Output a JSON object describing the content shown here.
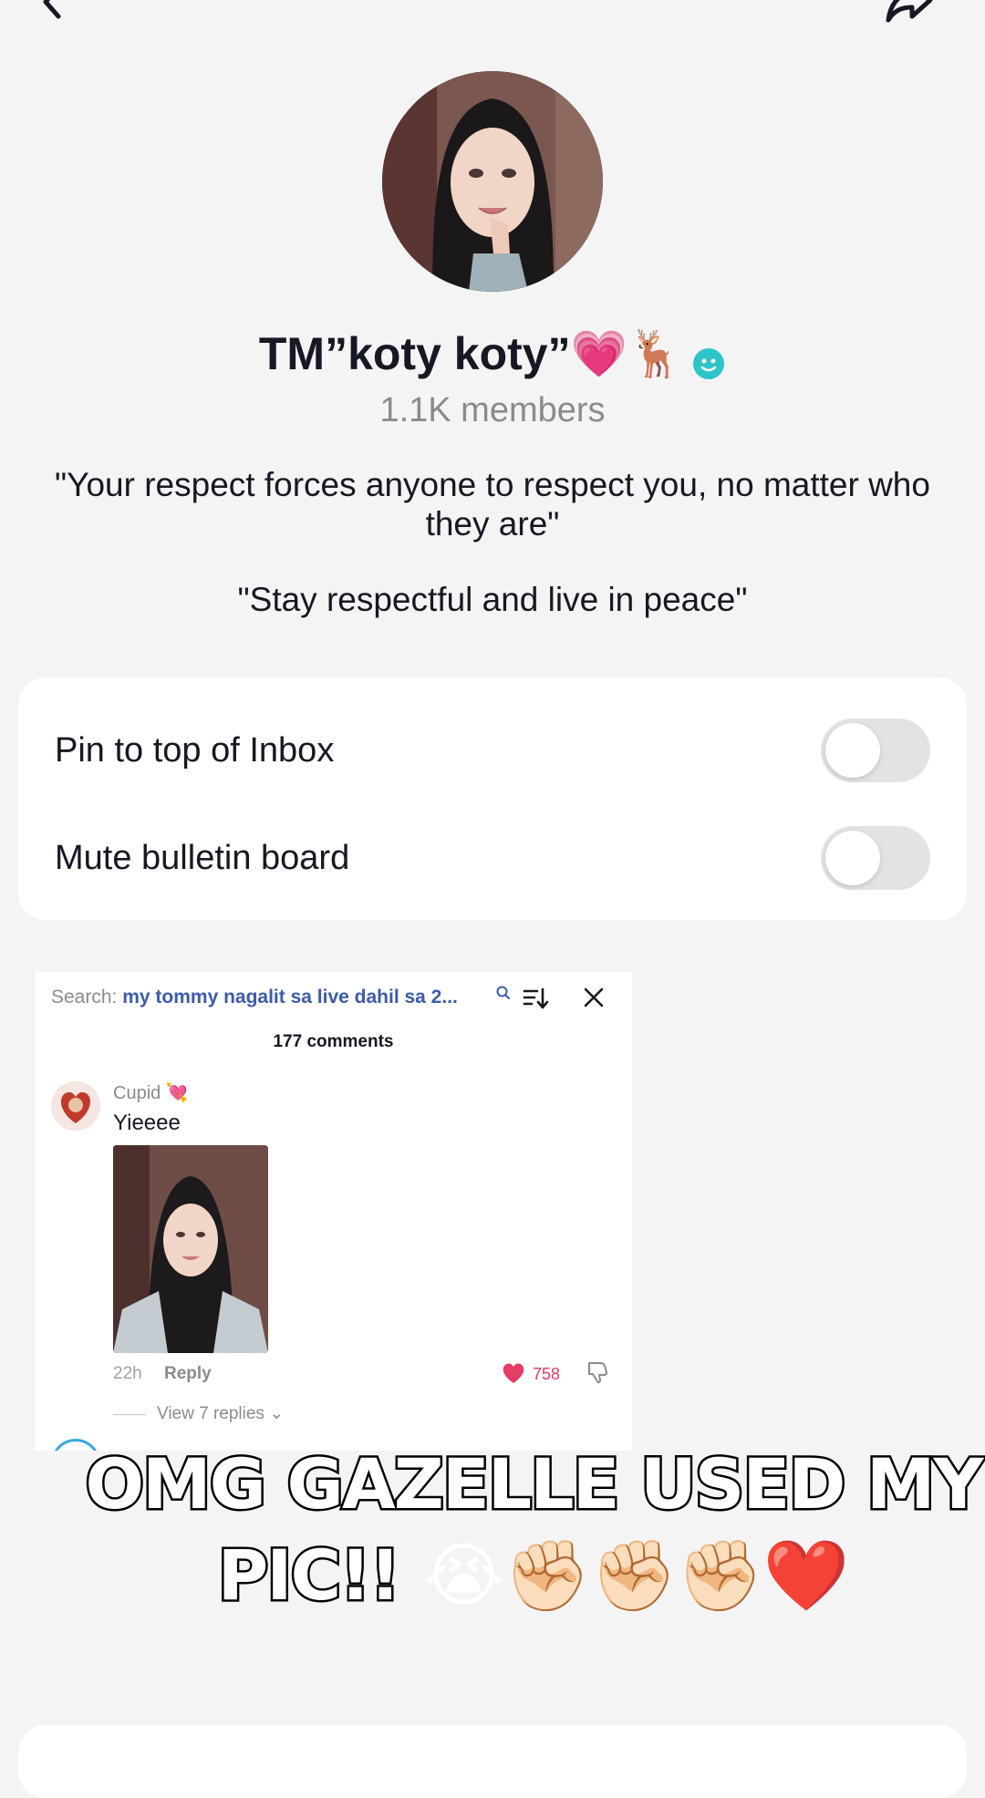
{
  "header": {
    "back_icon": "chevron-left-icon",
    "share_icon": "share-arrow-icon"
  },
  "group": {
    "name": "TM”koty koty”💗🦌",
    "verified_icon": "chat-bubble-icon",
    "members": "1.1K members",
    "description_line1": "\"Your respect forces anyone to respect you, no matter who they are\"",
    "description_line2": "\"Stay respectful and live in peace\""
  },
  "settings": {
    "pin_label": "Pin to top of Inbox",
    "pin_on": false,
    "mute_label": "Mute bulletin board",
    "mute_on": false
  },
  "embedded_screenshot": {
    "search_label": "Search:",
    "search_query": "my tommy nagalit sa live dahil sa 2...",
    "comments_count": "177 comments",
    "comment": {
      "user": "Cupid 💘",
      "text": "Yieeee",
      "time": "22h",
      "reply_label": "Reply",
      "likes": "758",
      "view_replies": "View 7 replies"
    }
  },
  "caption": {
    "line1": "OMG GAZELLE USED MY",
    "line2_text": "PIC!!",
    "line2_emoji": " 😭✊🏻✊🏻✊🏻❤️"
  },
  "colors": {
    "background": "#f4f4f5",
    "card": "#ffffff",
    "toggle_off": "#e3e3e5",
    "like_red": "#e53e66",
    "search_query_blue": "#3b5cab",
    "verified_teal": "#2cc4c8"
  }
}
